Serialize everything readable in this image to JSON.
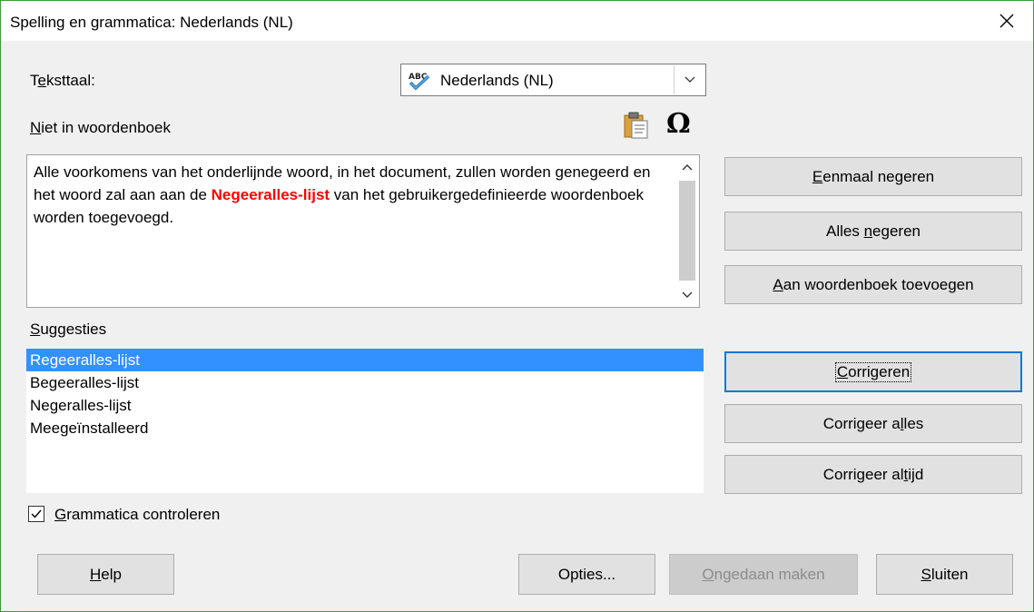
{
  "window": {
    "title": "Spelling en grammatica: Nederlands (NL)",
    "close_icon": "close-icon"
  },
  "language": {
    "label_prefix": "T",
    "label_underlined": "e",
    "label_rest": "ksttaal:",
    "selected": "Nederlands (NL)",
    "icon": "abc-check-icon"
  },
  "not_in_dict": {
    "label_underlined": "N",
    "label_rest": "iet in woordenboek",
    "text_before": "Alle voorkomens van het onderlijnde woord, in het document, zullen worden genegeerd en het woord zal aan aan de ",
    "highlighted_word": "Negeeralles-lijst",
    "text_after": " van het gebruikergedefinieerde woordenboek worden toegevoegd."
  },
  "side_buttons": {
    "ignore_once": {
      "u": "E",
      "rest": "enmaal negeren"
    },
    "ignore_all": {
      "pre": "Alles ",
      "u": "n",
      "rest": "egeren"
    },
    "add_to_dict": {
      "u": "A",
      "rest": "an woordenboek toevoegen"
    }
  },
  "suggestions": {
    "label_underlined": "S",
    "label_rest": "uggesties",
    "items": [
      "Regeeralles-lijst",
      "Begeeralles-lijst",
      "Negeralles-lijst",
      "Meegeïnstalleerd"
    ],
    "selected_index": 0
  },
  "correct_buttons": {
    "correct": {
      "u": "C",
      "rest": "orrigeren"
    },
    "correct_all": {
      "pre": "Corrigeer a",
      "u": "l",
      "rest": "les"
    },
    "always_correct": {
      "pre": "Corrigeer al",
      "u": "t",
      "rest": "ijd"
    }
  },
  "grammar": {
    "label_underlined": "G",
    "label_rest": "rammatica controleren",
    "checked": true
  },
  "footer": {
    "help": {
      "u": "H",
      "rest": "elp"
    },
    "options": "Opties...",
    "undo": {
      "u": "O",
      "rest": "ngedaan maken"
    },
    "close": {
      "u": "S",
      "rest": "luiten"
    }
  }
}
